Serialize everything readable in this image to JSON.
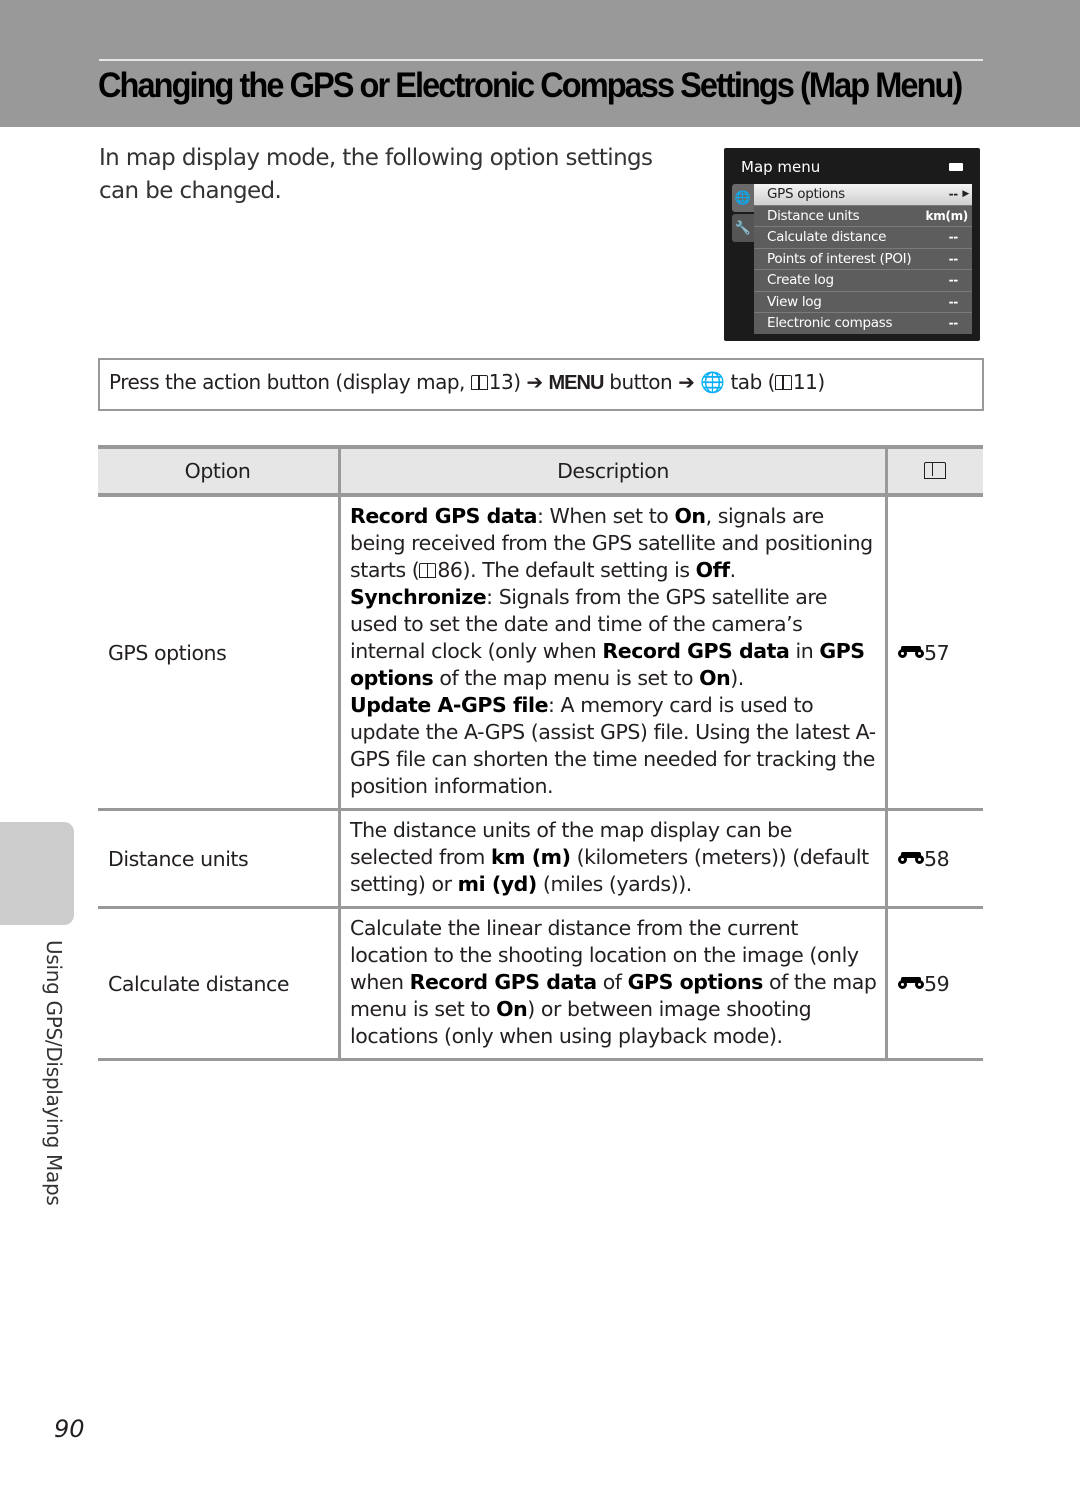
{
  "header": {
    "title": "Changing the GPS or Electronic Compass Settings (Map Menu)"
  },
  "intro": "In map display mode, the following option settings can be changed.",
  "camera_screen": {
    "title": "Map menu",
    "battery_icon": "battery-full-icon",
    "tabs": [
      {
        "icon": "globe-gps-icon",
        "active": true
      },
      {
        "icon": "wrench-icon",
        "active": false
      }
    ],
    "items": [
      {
        "label": "GPS options",
        "value": "--",
        "selected": true
      },
      {
        "label": "Distance units",
        "value": "km(m)"
      },
      {
        "label": "Calculate distance",
        "value": "--"
      },
      {
        "label": "Points of interest (POI)",
        "value": "--"
      },
      {
        "label": "Create log",
        "value": "--"
      },
      {
        "label": "View log",
        "value": "--"
      },
      {
        "label": "Electronic compass",
        "value": "--"
      }
    ]
  },
  "navigation": {
    "part1": "Press the action button (display map, ",
    "ref1": "13",
    "part2": ") ",
    "arrow": "➔",
    "menu_label": "MENU",
    "part3": " button ",
    "part4": " tab (",
    "ref2": "11",
    "part5": ")"
  },
  "table": {
    "headers": {
      "option": "Option",
      "description": "Description",
      "ref_icon": "book-icon"
    },
    "rows": [
      {
        "option": "GPS options",
        "ref": "57",
        "desc": {
          "a_b": "Record GPS data",
          "a_1": ": When set to ",
          "a_b2": "On",
          "a_2": ", signals are being received from the GPS satellite and positioning starts (",
          "a_ref": "86",
          "a_3": "). The default setting is ",
          "a_b3": "Off",
          "a_4": ".",
          "b_b": "Synchronize",
          "b_1": ": Signals from the GPS satellite are used to set the date and time of the camera’s internal clock (only when ",
          "b_b2": "Record GPS data",
          "b_2": " in ",
          "b_b3": "GPS options",
          "b_3": " of the map menu is set to ",
          "b_b4": "On",
          "b_4": ").",
          "c_b": "Update A-GPS file",
          "c_1": ": A memory card is used to update the A-GPS (assist GPS) file. Using the latest A-GPS file can shorten the time needed for tracking the position information."
        }
      },
      {
        "option": "Distance units",
        "ref": "58",
        "desc": {
          "t1": "The distance units of the map display can be selected from ",
          "b1": "km (m)",
          "t2": " (kilometers (meters)) (default setting) or ",
          "b2": "mi (yd)",
          "t3": " (miles (yards))."
        }
      },
      {
        "option": "Calculate distance",
        "ref": "59",
        "desc": {
          "t1": "Calculate the linear distance from the current location to the shooting location on the image (only when ",
          "b1": "Record GPS data",
          "t2": " of ",
          "b2": "GPS options",
          "t3": " of the map menu is set to ",
          "b3": "On",
          "t4": ") or between image shooting locations (only when using playback mode)."
        }
      }
    ]
  },
  "side_label": "Using GPS/Displaying Maps",
  "page_number": "90"
}
